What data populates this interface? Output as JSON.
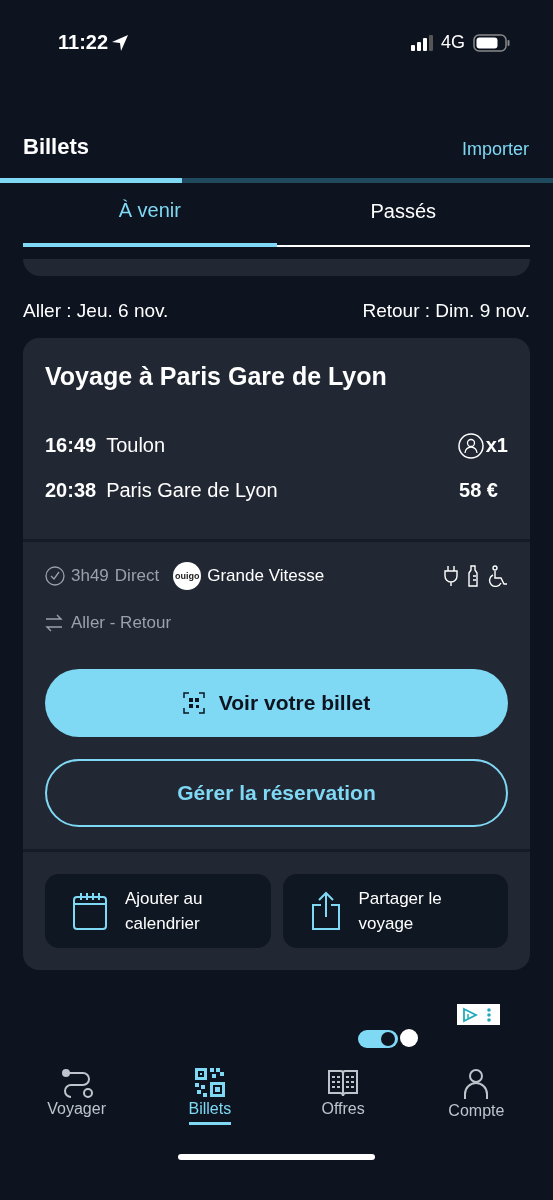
{
  "status_bar": {
    "time": "11:22",
    "network": "4G"
  },
  "header": {
    "title": "Billets",
    "action": "Importer"
  },
  "progress": {
    "level": 0.33
  },
  "tabs": [
    {
      "label": "À venir",
      "selected": true
    },
    {
      "label": "Passés",
      "selected": false
    }
  ],
  "dates": {
    "outbound": "Aller : Jeu. 6 nov.",
    "return": "Retour : Dim. 9 nov."
  },
  "trip": {
    "title": "Voyage à Paris Gare de Lyon",
    "stops": [
      {
        "time": "16:49",
        "station": "Toulon"
      },
      {
        "time": "20:38",
        "station": "Paris Gare de Lyon"
      }
    ],
    "passengers": "x1",
    "price": "58 €",
    "duration": "3h49",
    "connection": "Direct",
    "operator_logo": "ouigo",
    "service": "Grande Vitesse",
    "trip_type": "Aller - Retour",
    "primary_button": "Voir votre billet",
    "secondary_button": "Gérer la réservation",
    "actions": [
      {
        "kind": "calendar",
        "label": "Ajouter au calendrier"
      },
      {
        "kind": "share",
        "label": "Partager le voyage"
      }
    ]
  },
  "nav": [
    {
      "kind": "route",
      "label": "Voyager",
      "selected": false
    },
    {
      "kind": "qr",
      "label": "Billets",
      "selected": true
    },
    {
      "kind": "book",
      "label": "Offres",
      "selected": false
    },
    {
      "kind": "person",
      "label": "Compte",
      "selected": false
    }
  ]
}
